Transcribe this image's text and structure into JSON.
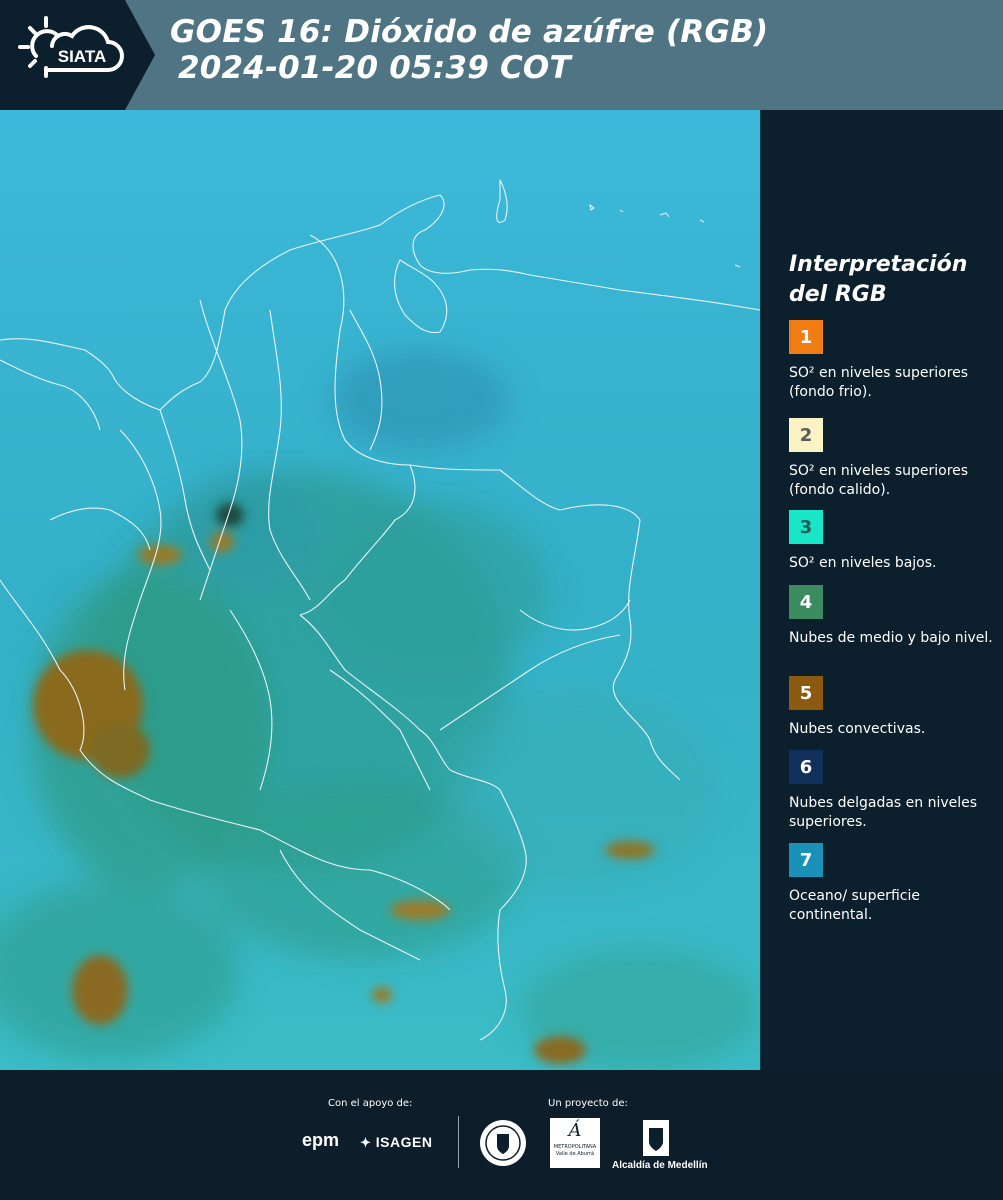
{
  "header": {
    "logo_text": "SIATA",
    "title_line1": "GOES 16: Dióxido de azúfre (RGB)",
    "title_line2": "2024-01-20 05:39 COT"
  },
  "legend": {
    "title_line1": "Interpretación",
    "title_line2": "del RGB",
    "items": [
      {
        "number": "1",
        "color": "#f07c14",
        "text_color": "#ffffff",
        "label": "SO² en niveles superiores (fondo frio)."
      },
      {
        "number": "2",
        "color": "#fbf3c4",
        "text_color": "#5a5a5a",
        "label": "SO² en niveles superiores (fondo calido)."
      },
      {
        "number": "3",
        "color": "#18e6c8",
        "text_color": "#2e5a56",
        "label": "SO² en niveles bajos."
      },
      {
        "number": "4",
        "color": "#3c8a60",
        "text_color": "#ffffff",
        "label": "Nubes de medio y bajo nivel."
      },
      {
        "number": "5",
        "color": "#8b5a10",
        "text_color": "#ffffff",
        "label": "Nubes convectivas."
      },
      {
        "number": "6",
        "color": "#102f5a",
        "text_color": "#ffffff",
        "label": "Nubes delgadas en niveles superiores."
      },
      {
        "number": "7",
        "color": "#1a92b8",
        "text_color": "#ffffff",
        "label": "Oceano/ superficie continental."
      }
    ]
  },
  "footer": {
    "support_label": "Con el apoyo de:",
    "project_label": "Un proyecto de:",
    "sponsor_epm": "epm",
    "sponsor_isagen": "ISAGEN",
    "partner_area_line1": "METROPOLITANA",
    "partner_area_line2": "Valle de Aburrá",
    "partner_alcaldia": "Alcaldía de Medellín"
  },
  "colors": {
    "header_bg": "#4f7483",
    "panel_bg": "#0c1f2c",
    "ocean": "#35b5d8",
    "land": "#38a9b0",
    "convective": "#8b6a1c",
    "borders": "#e8f2f5"
  }
}
